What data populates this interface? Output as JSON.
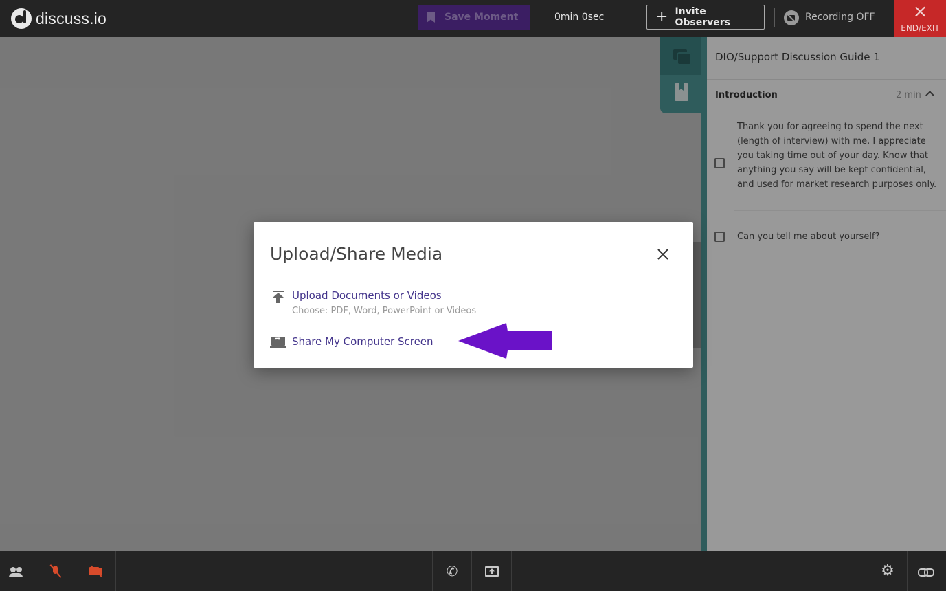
{
  "app": {
    "logo_text": "discuss.io"
  },
  "topbar": {
    "save_moment_label": "Save Moment",
    "timer": "0min 0sec",
    "invite_label": "Invite Observers",
    "invite_icon": "plus-icon",
    "recording_label": "Recording OFF",
    "end_exit_icon": "×",
    "end_exit_label": "END/EXIT"
  },
  "guide": {
    "title": "DIO/Support Discussion Guide 1",
    "section": {
      "name": "Introduction",
      "time": "2 min"
    },
    "questions": [
      {
        "text": "Thank you for agreeing to spend the next (length of interview) with me. I appreciate you taking time out of your day. Know that anything you say will be kept confidential, and used for market research purposes only.",
        "checked": false
      },
      {
        "text": "Can you tell me about yourself?",
        "checked": false
      }
    ]
  },
  "modal": {
    "title": "Upload/Share Media",
    "close_icon": "close-icon",
    "upload": {
      "label": "Upload Documents or Videos",
      "sub": "Choose: PDF, Word, PowerPoint or Videos"
    },
    "share": {
      "label": "Share My Computer Screen"
    }
  },
  "colors": {
    "topbar_bg": "#242424",
    "accent_teal": "#4f9999",
    "link_purple": "#44358c",
    "annotation_arrow": "#6a12c8",
    "end_exit_red": "#c62828",
    "muted_red": "#d84b2b"
  },
  "bottombar": {
    "phone_glyph": "✆",
    "gear_glyph": "⚙",
    "icons": [
      "participants-icon",
      "mic-off-icon",
      "camera-off-icon",
      "phone-icon",
      "share-screen-icon",
      "gear-icon",
      "link-icon"
    ]
  }
}
